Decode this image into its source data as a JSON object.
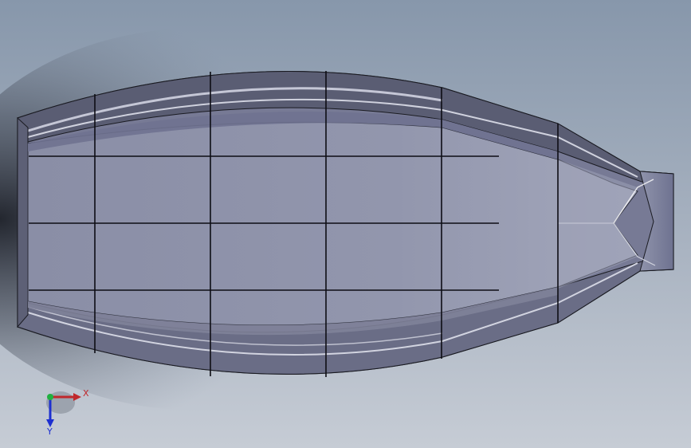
{
  "viewport": {
    "background_top": "#8a9aad",
    "background_bottom": "#c4cad3"
  },
  "model": {
    "shell_color": "#7c7f99",
    "floor_color": "#8d92a9",
    "edge_color": "#0d0d14",
    "highlight_color": "#c8cad8",
    "dark_band_color": "#4d5060"
  },
  "triad": {
    "x_label": "X",
    "y_label": "Y",
    "x_color": "#c0282c",
    "y_color": "#1d2fd0",
    "origin_color": "#20b040",
    "x_icon": "axis-x-arrow-icon",
    "y_icon": "axis-y-arrow-icon"
  }
}
